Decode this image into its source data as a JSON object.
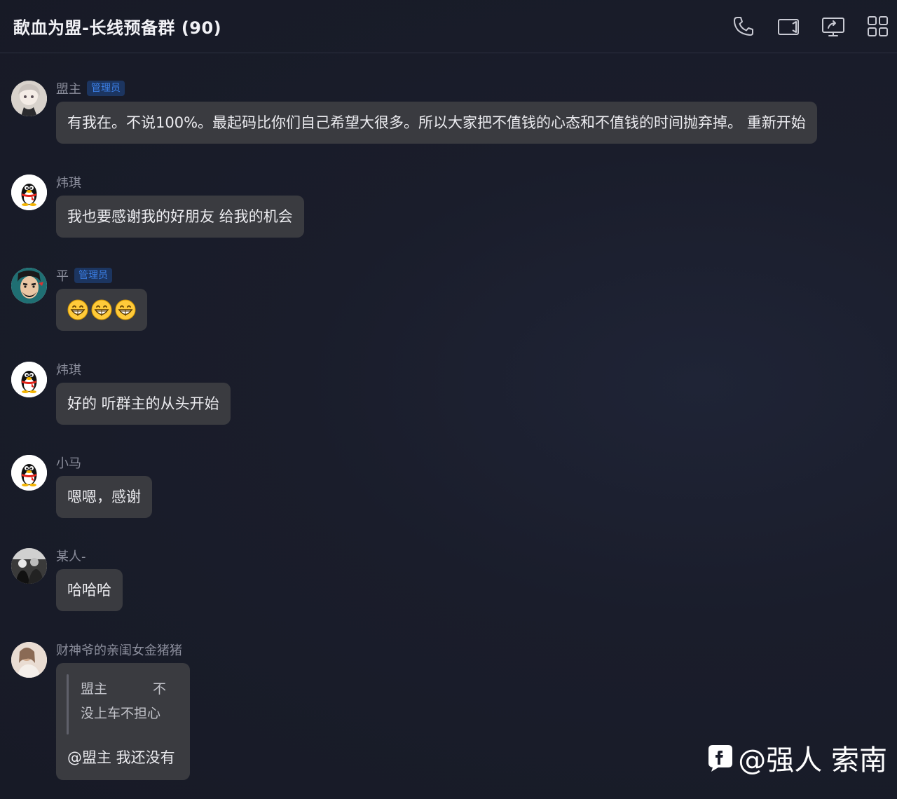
{
  "header": {
    "title": "歃血为盟-长线预备群 (90)",
    "icons": [
      "phone-icon",
      "video-call-icon",
      "screen-share-icon",
      "apps-icon"
    ]
  },
  "messages": [
    {
      "sender": "盟主",
      "badge": "管理员",
      "text": "有我在。不说100%。最起码比你们自己希望大很多。所以大家把不值钱的心态和不值钱的时间抛弃掉。 重新开始",
      "avatar": "anime-avatar"
    },
    {
      "sender": "炜琪",
      "badge": "",
      "text": "我也要感谢我的好朋友 给我的机会",
      "avatar": "qq-penguin-avatar"
    },
    {
      "sender": "平",
      "badge": "管理员",
      "emoji": [
        "grin-emoji",
        "grin-emoji",
        "grin-emoji"
      ],
      "avatar": "cartoon-avatar"
    },
    {
      "sender": "炜琪",
      "badge": "",
      "text": "好的 听群主的从头开始",
      "avatar": "qq-penguin-avatar"
    },
    {
      "sender": "小马",
      "badge": "",
      "text": "嗯嗯，感谢",
      "avatar": "qq-penguin-avatar"
    },
    {
      "sender": "某人-",
      "badge": "",
      "text": "哈哈哈",
      "avatar": "photo-avatar"
    },
    {
      "sender": "财神爷的亲闺女金猪猪",
      "badge": "",
      "avatar": "photo-avatar",
      "quote": {
        "author": "盟主",
        "mark": "不",
        "text": "没上车不担心"
      },
      "text": "@盟主 我还没有"
    }
  ],
  "watermark": {
    "text": "@强人 索南"
  },
  "colors": {
    "background": "#1a1d2b",
    "bubble": "#3a3b40",
    "badge_text": "#3b7fe6",
    "badge_bg": "#1c3560"
  }
}
